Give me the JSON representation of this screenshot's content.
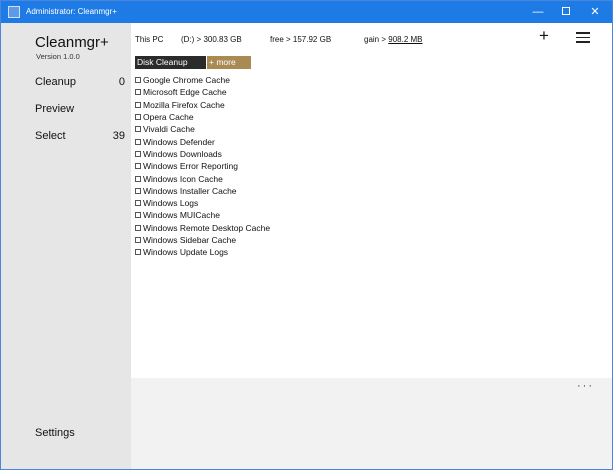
{
  "window": {
    "title": "Administrator: Cleanmgr+",
    "minimize": "—",
    "close": "✕"
  },
  "sidebar": {
    "app_title": "Cleanmgr+",
    "version": "Version 1.0.0",
    "items": [
      {
        "label": "Cleanup",
        "count": "0"
      },
      {
        "label": "Preview",
        "count": ""
      },
      {
        "label": "Select",
        "count": "39"
      }
    ],
    "settings": "Settings"
  },
  "info": {
    "pc": "This PC",
    "drive": "(D:) > 300.83 GB",
    "free": "free >  157.92 GB",
    "gain_label": "gain > ",
    "gain_value": "908.2 MB"
  },
  "toolbar": {
    "plus": "+",
    "disk_cleanup": "Disk Cleanup",
    "more": "+ more"
  },
  "list": [
    "Google Chrome Cache",
    "Microsoft Edge Cache",
    "Mozilla Firefox Cache",
    "Opera Cache",
    "Vivaldi Cache",
    "Windows Defender",
    "Windows Downloads",
    "Windows Error Reporting",
    "Windows Icon Cache",
    "Windows Installer Cache",
    "Windows Logs",
    "Windows MUICache",
    "Windows Remote Desktop Cache",
    "Windows Sidebar Cache",
    "Windows Update Logs"
  ],
  "footer": {
    "dots": "···"
  }
}
